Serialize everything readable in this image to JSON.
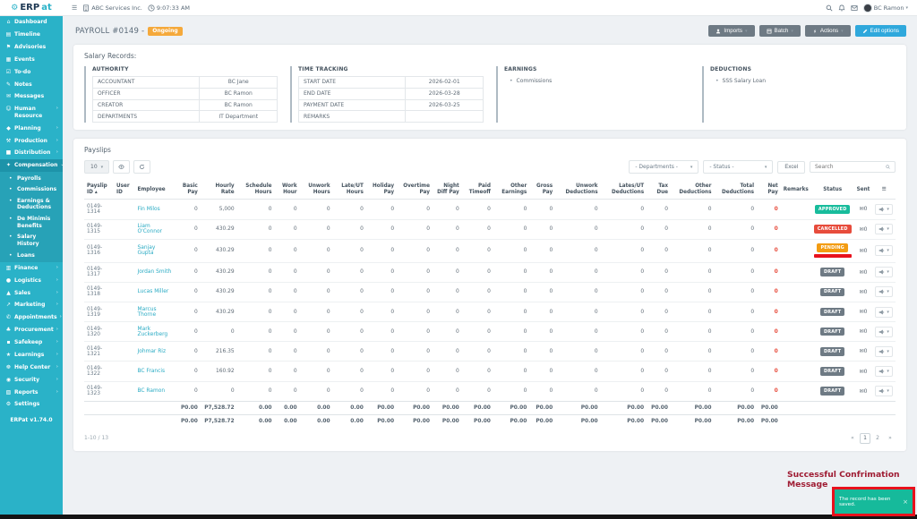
{
  "brand": {
    "logo_primary": "ERP",
    "logo_accent": "at",
    "gear_icon": "⚙"
  },
  "topbar": {
    "menu_icon": "☰",
    "company": "ABC Services Inc.",
    "time": "9:07:33 AM",
    "user": "BC Ramon"
  },
  "sidebar": {
    "version": "ERPat v1.74.0",
    "items": [
      {
        "label": "Dashboard",
        "icon": "⌂"
      },
      {
        "label": "Timeline",
        "icon": "▤"
      },
      {
        "label": "Advisories",
        "icon": "⚑"
      },
      {
        "label": "Events",
        "icon": "▦"
      },
      {
        "label": "To-do",
        "icon": "☑"
      },
      {
        "label": "Notes",
        "icon": "✎"
      },
      {
        "label": "Messages",
        "icon": "✉"
      },
      {
        "label": "Human Resource",
        "icon": "☺",
        "arrow": true
      },
      {
        "label": "Planning",
        "icon": "◆",
        "arrow": true
      },
      {
        "label": "Production",
        "icon": "⚒",
        "arrow": true
      },
      {
        "label": "Distribution",
        "icon": "■",
        "arrow": true
      },
      {
        "label": "Compensation",
        "icon": "✦",
        "expanded": true,
        "active": true,
        "children": [
          "Payrolls",
          "Commissions",
          "Earnings & Deductions",
          "De Minimis Benefits",
          "Salary History",
          "Loans"
        ]
      },
      {
        "label": "Finance",
        "icon": "▥",
        "arrow": true
      },
      {
        "label": "Logistics",
        "icon": "●",
        "arrow": true
      },
      {
        "label": "Sales",
        "icon": "▲",
        "arrow": true
      },
      {
        "label": "Marketing",
        "icon": "↗",
        "arrow": true
      },
      {
        "label": "Appointments",
        "icon": "✆",
        "arrow": true
      },
      {
        "label": "Procurement",
        "icon": "♣",
        "arrow": true
      },
      {
        "label": "Safekeep",
        "icon": "▪",
        "arrow": true
      },
      {
        "label": "Learnings",
        "icon": "★",
        "arrow": true
      },
      {
        "label": "Help Center",
        "icon": "☸",
        "arrow": true
      },
      {
        "label": "Security",
        "icon": "◉",
        "arrow": true
      },
      {
        "label": "Reports",
        "icon": "▧",
        "arrow": true
      },
      {
        "label": "Settings",
        "icon": "⚙"
      }
    ]
  },
  "page": {
    "title": "PAYROLL #0149 -",
    "status_badge": "Ongoing",
    "actions": {
      "imports": "Imports",
      "batch": "Batch",
      "actions": "Actions",
      "edit": "Edit options"
    }
  },
  "salary_records": {
    "title": "Salary Records:",
    "authority": {
      "title": "AUTHORITY",
      "rows": [
        [
          "ACCOUNTANT",
          "BC Jane"
        ],
        [
          "OFFICER",
          "BC Ramon"
        ],
        [
          "CREATOR",
          "BC Ramon"
        ],
        [
          "DEPARTMENTS",
          "IT Department"
        ]
      ]
    },
    "time_tracking": {
      "title": "TIME TRACKING",
      "rows": [
        [
          "START DATE",
          "2026-02-01"
        ],
        [
          "END DATE",
          "2026-03-28"
        ],
        [
          "PAYMENT DATE",
          "2026-03-25"
        ],
        [
          "REMARKS",
          ""
        ]
      ]
    },
    "earnings": {
      "title": "EARNINGS",
      "items": [
        "Commissions"
      ]
    },
    "deductions": {
      "title": "DEDUCTIONS",
      "items": [
        "SSS Salary Loan"
      ]
    }
  },
  "payslips": {
    "title": "Payslips",
    "toolbar": {
      "page_size": "10",
      "departments_filter": "- Departments -",
      "status_filter": "- Status -",
      "excel_label": "Excel",
      "search_placeholder": "Search"
    },
    "columns": [
      "Payslip ID",
      "User ID",
      "Employee",
      "Basic Pay",
      "Hourly Rate",
      "Schedule Hours",
      "Work Hour",
      "Unwork Hours",
      "Late/UT Hours",
      "Holiday Pay",
      "Overtime Pay",
      "Night Diff Pay",
      "Paid Timeoff",
      "Other Earnings",
      "Gross Pay",
      "Unwork Deductions",
      "Lates/UT Deductions",
      "Tax Due",
      "Other Deductions",
      "Total Deductions",
      "Net Pay",
      "Remarks",
      "Status",
      "Sent",
      "☰"
    ],
    "rows": [
      {
        "id": "0149-1314",
        "user_id": "",
        "employee": "Fin Milos",
        "numeric": [
          "0",
          "5,000",
          "0",
          "0",
          "0",
          "0",
          "0",
          "0",
          "0",
          "0",
          "0",
          "0",
          "0",
          "0",
          "0",
          "0",
          "0",
          "0"
        ],
        "remarks": "",
        "status": "APPROVED",
        "sent": "0"
      },
      {
        "id": "0149-1315",
        "user_id": "",
        "employee": "Liam O'Connor",
        "numeric": [
          "0",
          "430.29",
          "0",
          "0",
          "0",
          "0",
          "0",
          "0",
          "0",
          "0",
          "0",
          "0",
          "0",
          "0",
          "0",
          "0",
          "0",
          "0"
        ],
        "remarks": "",
        "status": "CANCELLED",
        "sent": "0"
      },
      {
        "id": "0149-1316",
        "user_id": "",
        "employee": "Sanjay Gupta",
        "numeric": [
          "0",
          "430.29",
          "0",
          "0",
          "0",
          "0",
          "0",
          "0",
          "0",
          "0",
          "0",
          "0",
          "0",
          "0",
          "0",
          "0",
          "0",
          "0"
        ],
        "remarks": "",
        "status": "PENDING",
        "sent": "0",
        "marked": true
      },
      {
        "id": "0149-1317",
        "user_id": "",
        "employee": "Jordan Smith",
        "numeric": [
          "0",
          "430.29",
          "0",
          "0",
          "0",
          "0",
          "0",
          "0",
          "0",
          "0",
          "0",
          "0",
          "0",
          "0",
          "0",
          "0",
          "0",
          "0"
        ],
        "remarks": "",
        "status": "DRAFT",
        "sent": "0"
      },
      {
        "id": "0149-1318",
        "user_id": "",
        "employee": "Lucas Miller",
        "numeric": [
          "0",
          "430.29",
          "0",
          "0",
          "0",
          "0",
          "0",
          "0",
          "0",
          "0",
          "0",
          "0",
          "0",
          "0",
          "0",
          "0",
          "0",
          "0"
        ],
        "remarks": "",
        "status": "DRAFT",
        "sent": "0"
      },
      {
        "id": "0149-1319",
        "user_id": "",
        "employee": "Marcus Thorne",
        "numeric": [
          "0",
          "430.29",
          "0",
          "0",
          "0",
          "0",
          "0",
          "0",
          "0",
          "0",
          "0",
          "0",
          "0",
          "0",
          "0",
          "0",
          "0",
          "0"
        ],
        "remarks": "",
        "status": "DRAFT",
        "sent": "0"
      },
      {
        "id": "0149-1320",
        "user_id": "",
        "employee": "Mark Zuckerberg",
        "numeric": [
          "0",
          "0",
          "0",
          "0",
          "0",
          "0",
          "0",
          "0",
          "0",
          "0",
          "0",
          "0",
          "0",
          "0",
          "0",
          "0",
          "0",
          "0"
        ],
        "remarks": "",
        "status": "DRAFT",
        "sent": "0"
      },
      {
        "id": "0149-1321",
        "user_id": "",
        "employee": "Johmar Riz",
        "numeric": [
          "0",
          "216.35",
          "0",
          "0",
          "0",
          "0",
          "0",
          "0",
          "0",
          "0",
          "0",
          "0",
          "0",
          "0",
          "0",
          "0",
          "0",
          "0"
        ],
        "remarks": "",
        "status": "DRAFT",
        "sent": "0"
      },
      {
        "id": "0149-1322",
        "user_id": "",
        "employee": "BC Francis",
        "numeric": [
          "0",
          "160.92",
          "0",
          "0",
          "0",
          "0",
          "0",
          "0",
          "0",
          "0",
          "0",
          "0",
          "0",
          "0",
          "0",
          "0",
          "0",
          "0"
        ],
        "remarks": "",
        "status": "DRAFT",
        "sent": "0"
      },
      {
        "id": "0149-1323",
        "user_id": "",
        "employee": "BC Ramon",
        "numeric": [
          "0",
          "0",
          "0",
          "0",
          "0",
          "0",
          "0",
          "0",
          "0",
          "0",
          "0",
          "0",
          "0",
          "0",
          "0",
          "0",
          "0",
          "0"
        ],
        "remarks": "",
        "status": "DRAFT",
        "sent": "0"
      }
    ],
    "summary_rows": [
      [
        "P0.00",
        "P7,528.72",
        "0.00",
        "0.00",
        "0.00",
        "0.00",
        "P0.00",
        "P0.00",
        "P0.00",
        "P0.00",
        "P0.00",
        "P0.00",
        "P0.00",
        "P0.00",
        "P0.00",
        "P0.00",
        "P0.00",
        "P0.00"
      ],
      [
        "P0.00",
        "P7,528.72",
        "0.00",
        "0.00",
        "0.00",
        "0.00",
        "P0.00",
        "P0.00",
        "P0.00",
        "P0.00",
        "P0.00",
        "P0.00",
        "P0.00",
        "P0.00",
        "P0.00",
        "P0.00",
        "P0.00",
        "P0.00"
      ]
    ],
    "footer": {
      "range": "1-10 / 13",
      "pages": [
        "«",
        "1",
        "2",
        "»"
      ],
      "active_page": "1"
    }
  },
  "annotation": {
    "label": "Successful Confrimation Message",
    "toast": "The record has been saved.",
    "close": "×"
  },
  "colors": {
    "sidebar": "#2ab2c8",
    "sidebar_active": "#1d93a9",
    "primary_button": "#2fa8dc",
    "gray_button": "#6e7a84",
    "ongoing_badge": "#f5a93b",
    "approved": "#18bc9c",
    "cancelled": "#e74c3c",
    "pending": "#f39c12",
    "draft": "#6e7a84",
    "toast": "#16ba9b",
    "highlight": "#e8111c",
    "annotation_text": "#9e1b32",
    "link": "#2aabc4",
    "net_pay": "#e74c3c"
  }
}
